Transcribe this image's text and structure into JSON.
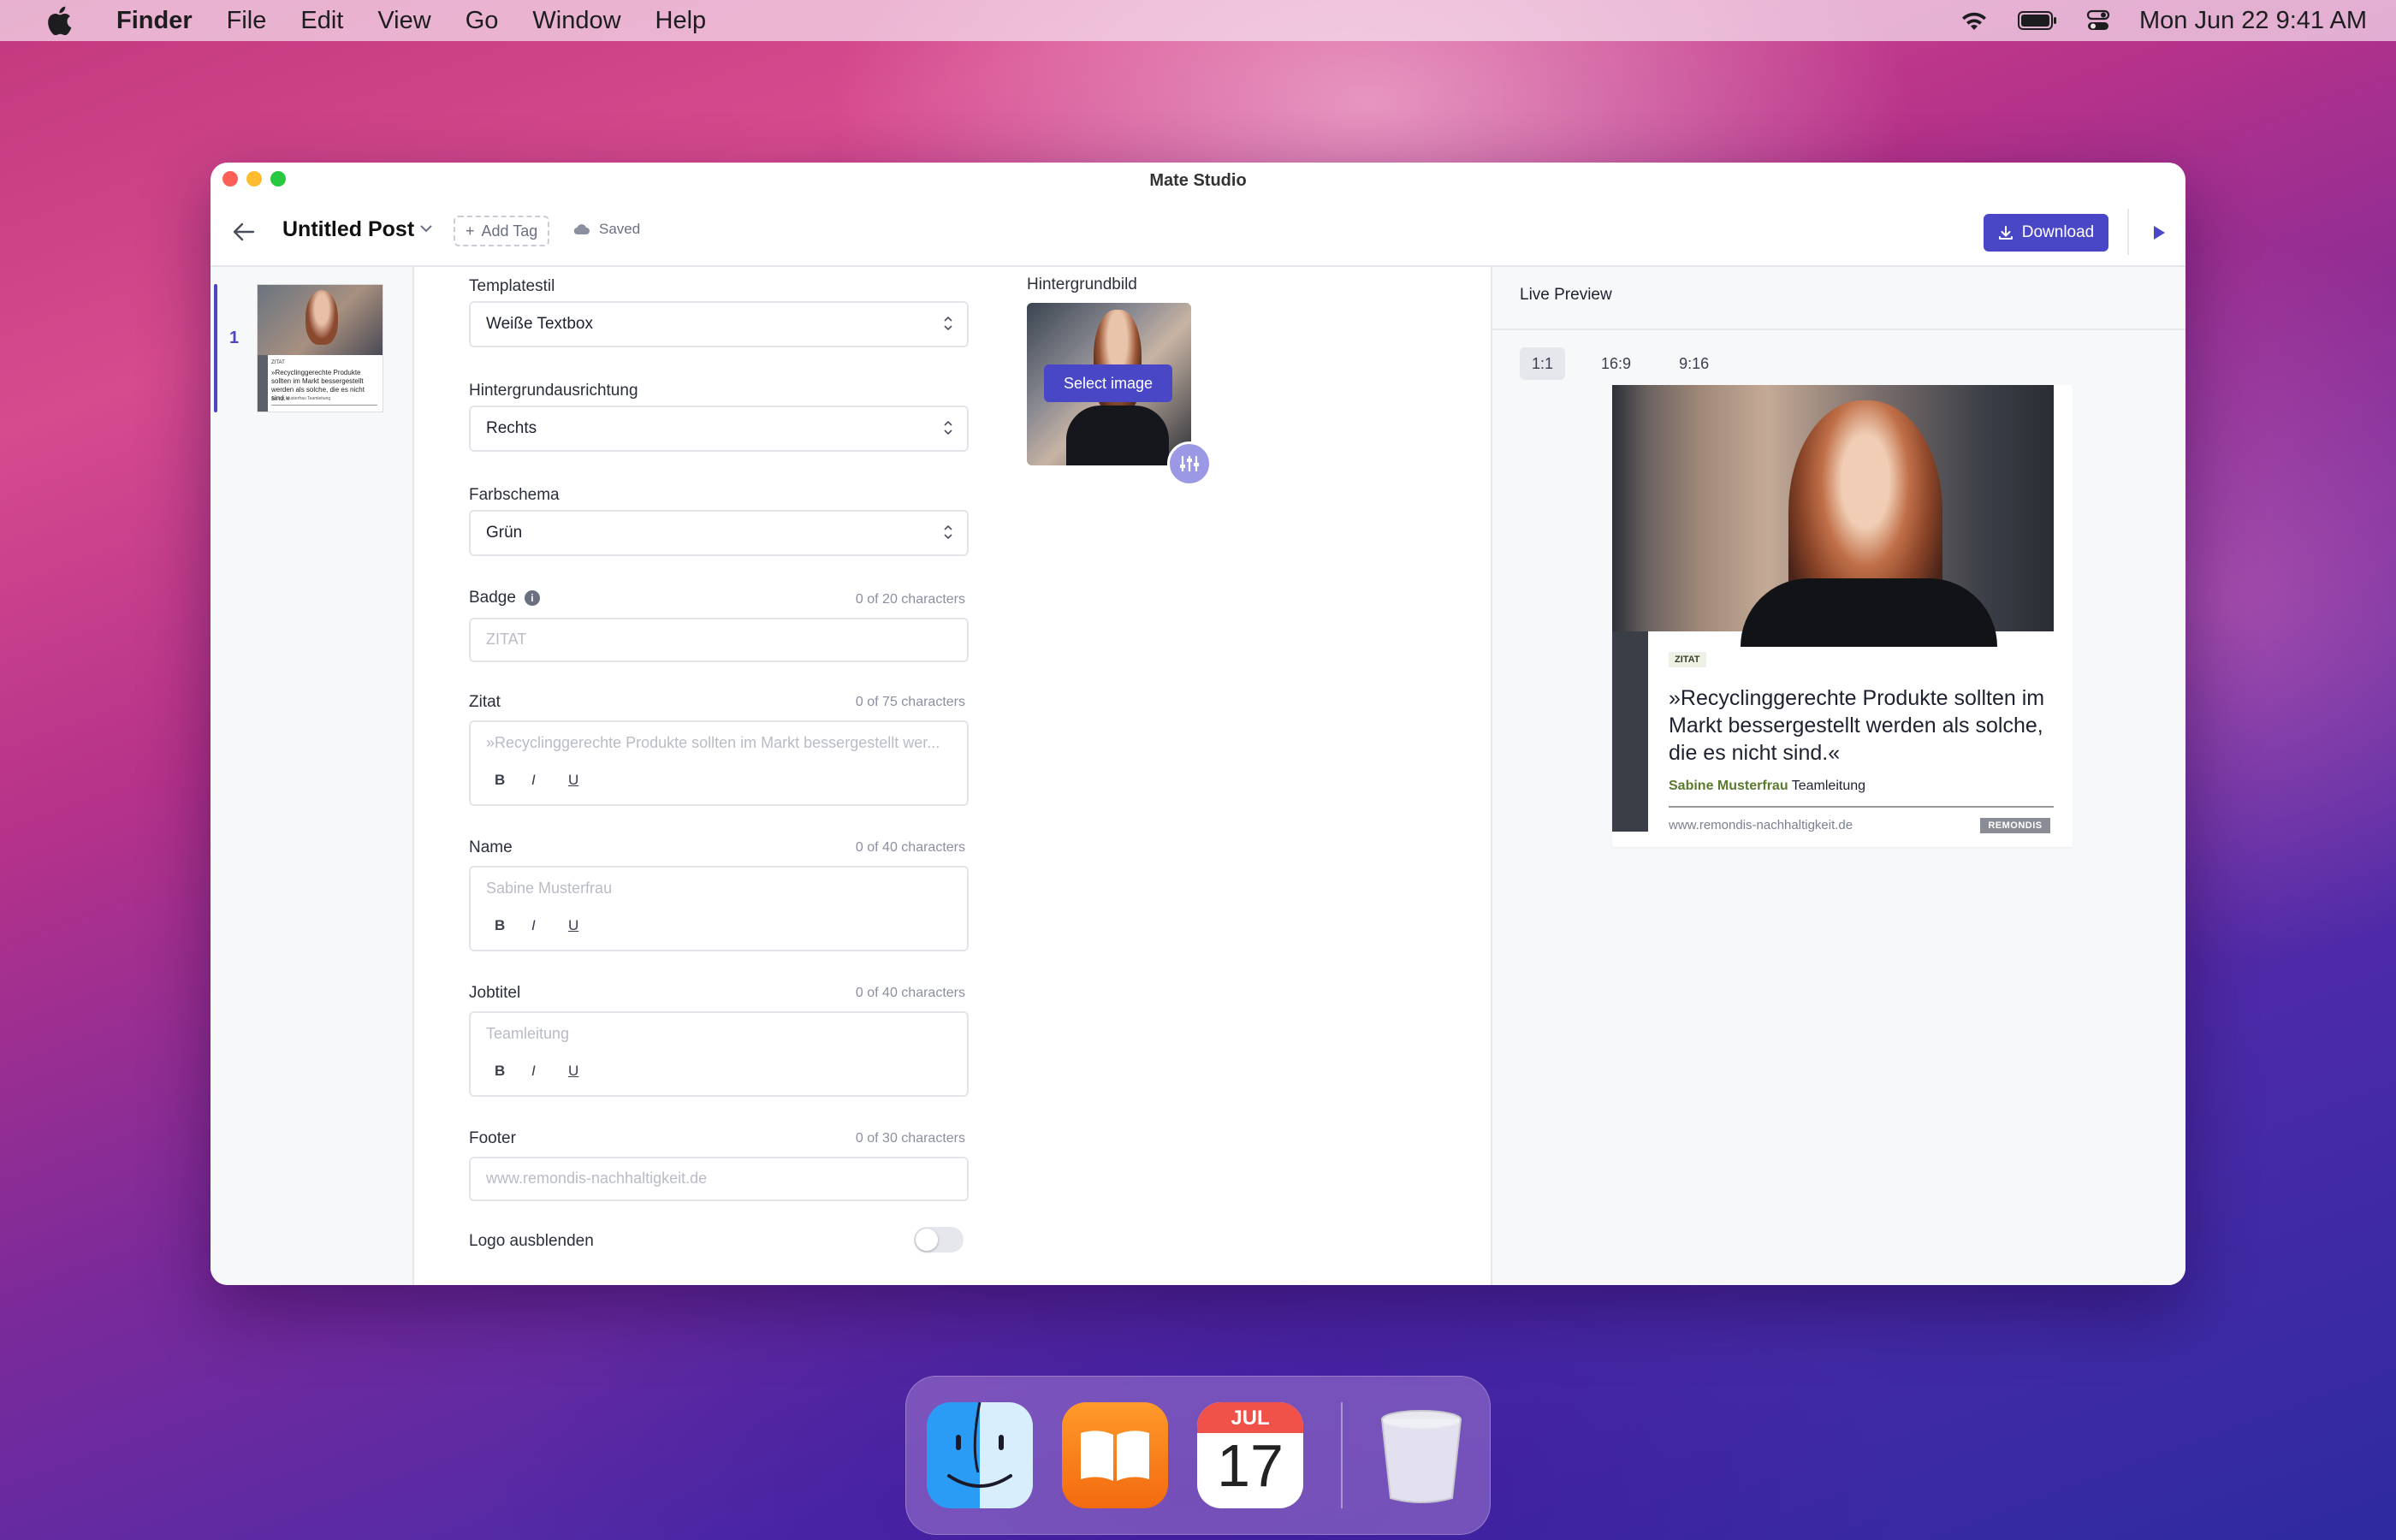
{
  "menubar": {
    "app": "Finder",
    "items": [
      "File",
      "Edit",
      "View",
      "Go",
      "Window",
      "Help"
    ],
    "clock": "Mon Jun 22  9:41 AM"
  },
  "window": {
    "title": "Mate Studio",
    "post_title": "Untitled Post",
    "add_tag": "Add Tag",
    "saved": "Saved",
    "download": "Download"
  },
  "slides": {
    "number": "1",
    "thumb_badge": "ZITAT",
    "thumb_quote": "»Recyclinggerechte Produkte sollten im Markt bessergestellt werden als solche, die es nicht sind.«",
    "thumb_name": "Sabine Musterfrau Teamleitung"
  },
  "form": {
    "template_label": "Templatestil",
    "template_value": "Weiße Textbox",
    "alignment_label": "Hintergrundausrichtung",
    "alignment_value": "Rechts",
    "scheme_label": "Farbschema",
    "scheme_value": "Grün",
    "badge_label": "Badge",
    "badge_count": "0 of 20 characters",
    "badge_placeholder": "ZITAT",
    "quote_label": "Zitat",
    "quote_count": "0 of 75 characters",
    "quote_placeholder": "»Recyclinggerechte Produkte sollten im Markt bessergestellt wer...",
    "name_label": "Name",
    "name_count": "0 of 40 characters",
    "name_placeholder": "Sabine Musterfrau",
    "job_label": "Jobtitel",
    "job_count": "0 of 40 characters",
    "job_placeholder": "Teamleitung",
    "footer_label": "Footer",
    "footer_count": "0 of 30 characters",
    "footer_placeholder": "www.remondis-nachhaltigkeit.de",
    "logo_label": "Logo ausblenden",
    "fmt_bold": "B",
    "fmt_italic": "I",
    "fmt_underline": "U",
    "bg_image_label": "Hintergrundbild",
    "select_image": "Select image"
  },
  "preview": {
    "title": "Live Preview",
    "ratios": [
      "1:1",
      "16:9",
      "9:16"
    ],
    "badge": "ZITAT",
    "quote": "»Recyclinggerechte Produkte sollten im Markt bessergestellt werden als solche, die es nicht sind.«",
    "name": "Sabine Musterfrau",
    "job": "Teamleitung",
    "footer": "www.remondis-nachhaltigkeit.de",
    "logo": "REMONDIS"
  },
  "dock": {
    "calendar_month": "JUL",
    "calendar_day": "17"
  },
  "colors": {
    "accent": "#4a47c7",
    "name_green": "#5a7a2e"
  }
}
